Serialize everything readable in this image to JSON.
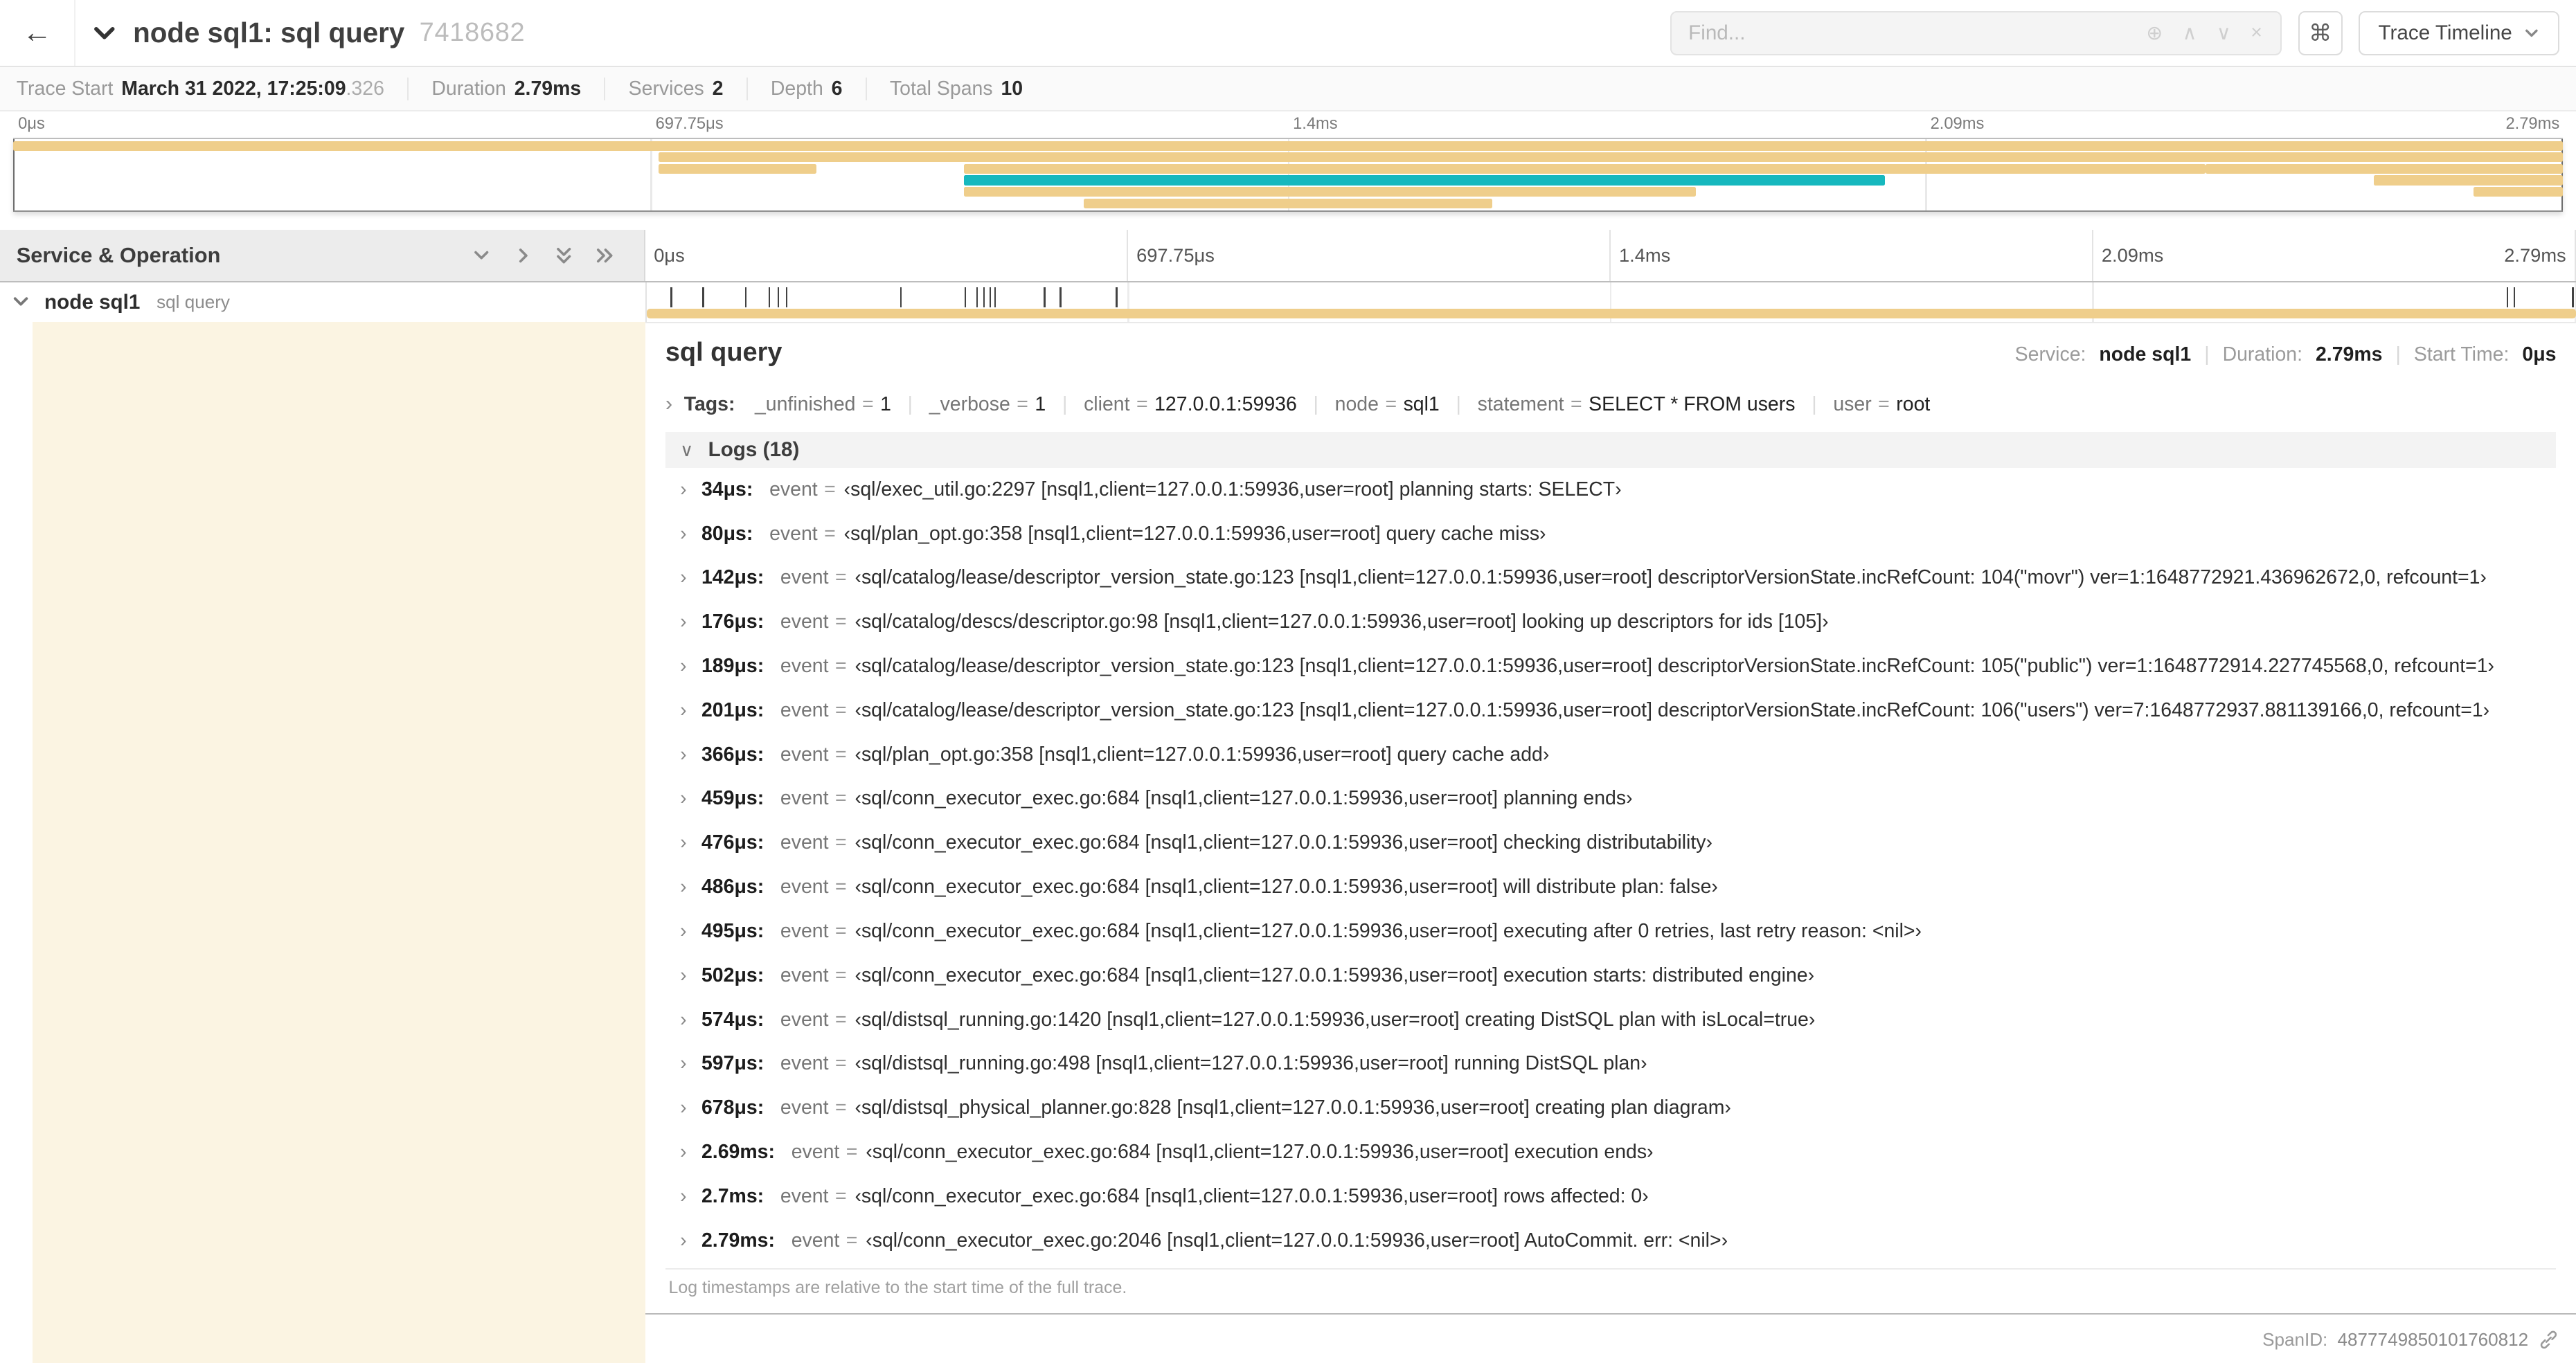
{
  "icons": {
    "back": "←",
    "chevron_right": "›",
    "chevron_down": "∨",
    "find_zoom": "⊕",
    "find_prev": "∧",
    "find_next": "∨",
    "find_clear": "×",
    "shortcut": "⌘"
  },
  "header": {
    "title": "node sql1: sql query",
    "trace_id": "7418682",
    "find_placeholder": "Find...",
    "view_button": "Trace Timeline"
  },
  "summary": {
    "items": [
      {
        "label": "Trace Start",
        "value": "March 31 2022, 17:25:09",
        "muted_suffix": ".326"
      },
      {
        "label": "Duration",
        "value": "2.79ms"
      },
      {
        "label": "Services",
        "value": "2"
      },
      {
        "label": "Depth",
        "value": "6"
      },
      {
        "label": "Total Spans",
        "value": "10"
      }
    ]
  },
  "timeline": {
    "duration_us": 2790,
    "ticks": [
      {
        "pos": 0,
        "label": "0μs"
      },
      {
        "pos": 25,
        "label": "697.75μs"
      },
      {
        "pos": 50,
        "label": "1.4ms"
      },
      {
        "pos": 75,
        "label": "2.09ms"
      },
      {
        "pos": 100,
        "label": "2.79ms"
      }
    ]
  },
  "minimap": {
    "spans": [
      {
        "row": 0,
        "start": 0,
        "end": 100,
        "color": "tan"
      },
      {
        "row": 1,
        "start": 25.3,
        "end": 100,
        "color": "tan"
      },
      {
        "row": 2,
        "start": 25.3,
        "end": 31.5,
        "color": "tan"
      },
      {
        "row": 2,
        "start": 37.3,
        "end": 86,
        "color": "tan"
      },
      {
        "row": 3,
        "start": 37.3,
        "end": 73.4,
        "color": "teal"
      },
      {
        "row": 4,
        "start": 37.3,
        "end": 66,
        "color": "tan"
      },
      {
        "row": 5,
        "start": 42,
        "end": 58,
        "color": "tan"
      },
      {
        "row": 2,
        "start": 86,
        "end": 100,
        "color": "tan"
      },
      {
        "row": 3,
        "start": 92.6,
        "end": 100,
        "color": "tan"
      },
      {
        "row": 4,
        "start": 96.5,
        "end": 100,
        "color": "tan"
      }
    ]
  },
  "left_panel": {
    "title": "Service & Operation",
    "row": {
      "service": "node sql1",
      "operation": "sql query"
    }
  },
  "detail": {
    "title": "sql query",
    "service_label": "Service:",
    "service": "node sql1",
    "duration_label": "Duration:",
    "duration": "2.79ms",
    "start_label": "Start Time:",
    "start": "0μs",
    "meta_separator": "|",
    "tags_label": "Tags:",
    "tags": [
      {
        "key": "_unfinished",
        "value": "1"
      },
      {
        "key": "_verbose",
        "value": "1"
      },
      {
        "key": "client",
        "value": "127.0.0.1:59936"
      },
      {
        "key": "node",
        "value": "sql1"
      },
      {
        "key": "statement",
        "value": "SELECT * FROM users"
      },
      {
        "key": "user",
        "value": "root"
      }
    ],
    "logs_label": "Logs (18)",
    "logs": [
      {
        "t": "34μs:",
        "t_us": 34,
        "key": "event",
        "event": "‹sql/exec_util.go:2297 [nsql1,client=127.0.0.1:59936,user=root] planning starts: SELECT›"
      },
      {
        "t": "80μs:",
        "t_us": 80,
        "key": "event",
        "event": "‹sql/plan_opt.go:358 [nsql1,client=127.0.0.1:59936,user=root] query cache miss›"
      },
      {
        "t": "142μs:",
        "t_us": 142,
        "key": "event",
        "event": "‹sql/catalog/lease/descriptor_version_state.go:123 [nsql1,client=127.0.0.1:59936,user=root] descriptorVersionState.incRefCount: 104(\"movr\") ver=1:1648772921.436962672,0, refcount=1›"
      },
      {
        "t": "176μs:",
        "t_us": 176,
        "key": "event",
        "event": "‹sql/catalog/descs/descriptor.go:98 [nsql1,client=127.0.0.1:59936,user=root] looking up descriptors for ids [105]›"
      },
      {
        "t": "189μs:",
        "t_us": 189,
        "key": "event",
        "event": "‹sql/catalog/lease/descriptor_version_state.go:123 [nsql1,client=127.0.0.1:59936,user=root] descriptorVersionState.incRefCount: 105(\"public\") ver=1:1648772914.227745568,0, refcount=1›"
      },
      {
        "t": "201μs:",
        "t_us": 201,
        "key": "event",
        "event": "‹sql/catalog/lease/descriptor_version_state.go:123 [nsql1,client=127.0.0.1:59936,user=root] descriptorVersionState.incRefCount: 106(\"users\") ver=7:1648772937.881139166,0, refcount=1›"
      },
      {
        "t": "366μs:",
        "t_us": 366,
        "key": "event",
        "event": "‹sql/plan_opt.go:358 [nsql1,client=127.0.0.1:59936,user=root] query cache add›"
      },
      {
        "t": "459μs:",
        "t_us": 459,
        "key": "event",
        "event": "‹sql/conn_executor_exec.go:684 [nsql1,client=127.0.0.1:59936,user=root] planning ends›"
      },
      {
        "t": "476μs:",
        "t_us": 476,
        "key": "event",
        "event": "‹sql/conn_executor_exec.go:684 [nsql1,client=127.0.0.1:59936,user=root] checking distributability›"
      },
      {
        "t": "486μs:",
        "t_us": 486,
        "key": "event",
        "event": "‹sql/conn_executor_exec.go:684 [nsql1,client=127.0.0.1:59936,user=root] will distribute plan: false›"
      },
      {
        "t": "495μs:",
        "t_us": 495,
        "key": "event",
        "event": "‹sql/conn_executor_exec.go:684 [nsql1,client=127.0.0.1:59936,user=root] executing after 0 retries, last retry reason: <nil>›"
      },
      {
        "t": "502μs:",
        "t_us": 502,
        "key": "event",
        "event": "‹sql/conn_executor_exec.go:684 [nsql1,client=127.0.0.1:59936,user=root] execution starts: distributed engine›"
      },
      {
        "t": "574μs:",
        "t_us": 574,
        "key": "event",
        "event": "‹sql/distsql_running.go:1420 [nsql1,client=127.0.0.1:59936,user=root] creating DistSQL plan with isLocal=true›"
      },
      {
        "t": "597μs:",
        "t_us": 597,
        "key": "event",
        "event": "‹sql/distsql_running.go:498 [nsql1,client=127.0.0.1:59936,user=root] running DistSQL plan›"
      },
      {
        "t": "678μs:",
        "t_us": 678,
        "key": "event",
        "event": "‹sql/distsql_physical_planner.go:828 [nsql1,client=127.0.0.1:59936,user=root] creating plan diagram›"
      },
      {
        "t": "2.69ms:",
        "t_us": 2690,
        "key": "event",
        "event": "‹sql/conn_executor_exec.go:684 [nsql1,client=127.0.0.1:59936,user=root] execution ends›"
      },
      {
        "t": "2.7ms:",
        "t_us": 2700,
        "key": "event",
        "event": "‹sql/conn_executor_exec.go:684 [nsql1,client=127.0.0.1:59936,user=root] rows affected: 0›"
      },
      {
        "t": "2.79ms:",
        "t_us": 2790,
        "key": "event",
        "event": "‹sql/conn_executor_exec.go:2046 [nsql1,client=127.0.0.1:59936,user=root] AutoCommit. err: <nil>›"
      }
    ],
    "logs_note": "Log timestamps are relative to the start time of the full trace.",
    "span_id_label": "SpanID:",
    "span_id": "4877749850101760812"
  },
  "colors": {
    "span_tan": "#EFCE8B",
    "span_teal": "#17B8BE",
    "row_tint": "#FBF4E2"
  }
}
